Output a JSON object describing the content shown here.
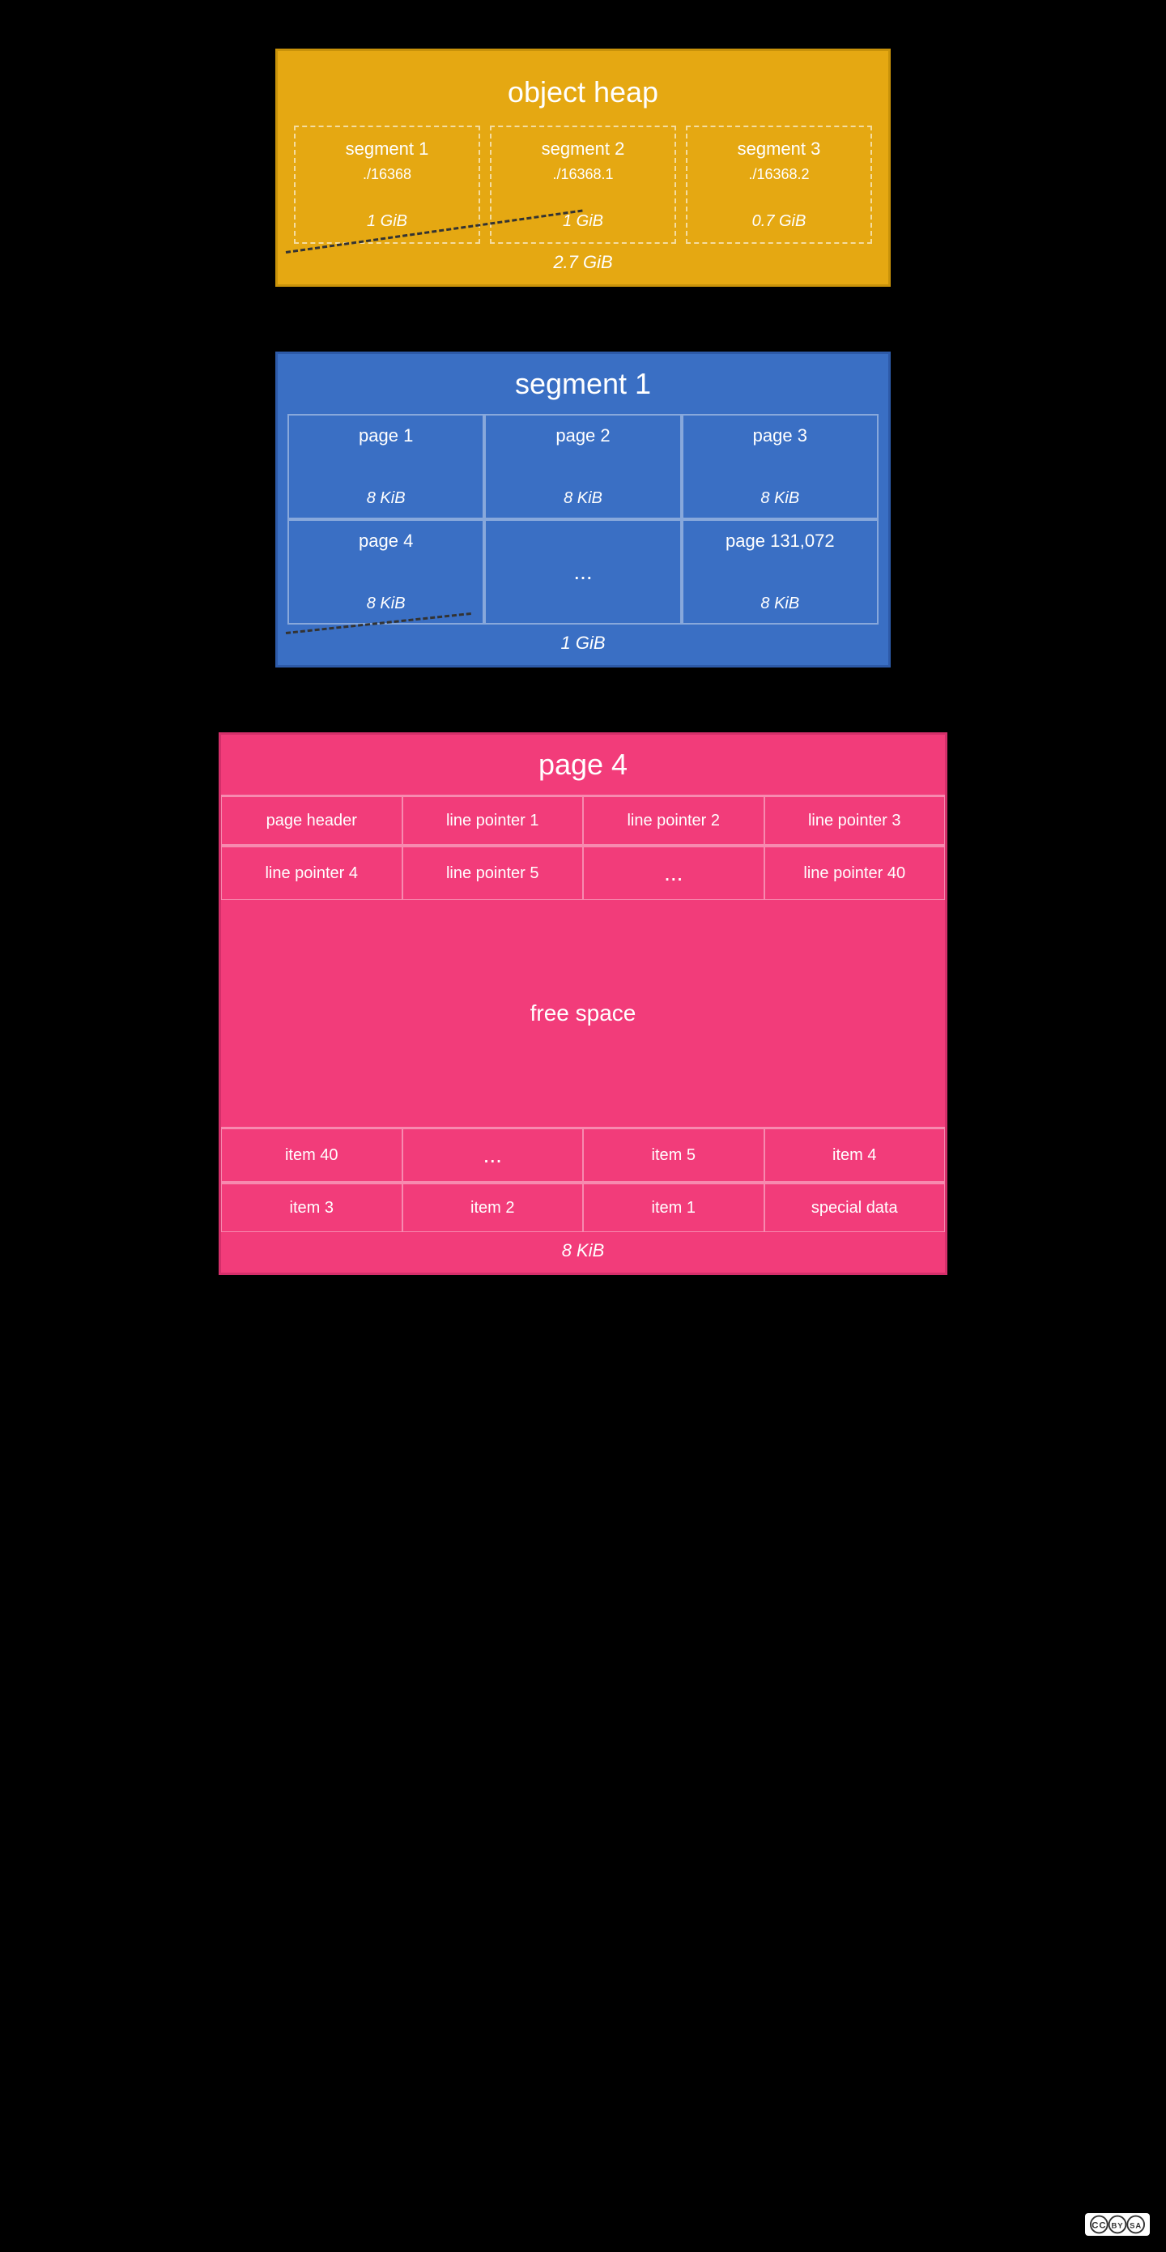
{
  "objectHeap": {
    "title": "object heap",
    "segments": [
      {
        "name": "segment 1",
        "file": "./16368",
        "size": "1 GiB"
      },
      {
        "name": "segment 2",
        "file": "./16368.1",
        "size": "1 GiB"
      },
      {
        "name": "segment 3",
        "file": "./16368.2",
        "size": "0.7 GiB"
      }
    ],
    "totalSize": "2.7 GiB"
  },
  "segment1": {
    "title": "segment 1",
    "pages": [
      {
        "name": "page 1",
        "size": "8 KiB"
      },
      {
        "name": "page 2",
        "size": "8 KiB"
      },
      {
        "name": "page 3",
        "size": "8 KiB"
      },
      {
        "name": "page 4",
        "size": "8 KiB"
      },
      {
        "name": "...",
        "size": ""
      },
      {
        "name": "page 131,072",
        "size": "8 KiB"
      }
    ],
    "totalSize": "1 GiB"
  },
  "page4": {
    "title": "page 4",
    "topCells": [
      "page header",
      "line pointer 1",
      "line pointer 2",
      "line pointer 3",
      "line pointer 4",
      "line pointer 5",
      "...",
      "line pointer 40"
    ],
    "freeSpace": "free space",
    "bottomCells": [
      "item 40",
      "...",
      "item 5",
      "item 4",
      "item 3",
      "item 2",
      "item 1",
      "special data"
    ],
    "totalSize": "8 KiB"
  },
  "license": {
    "text": "CC BY SA"
  }
}
